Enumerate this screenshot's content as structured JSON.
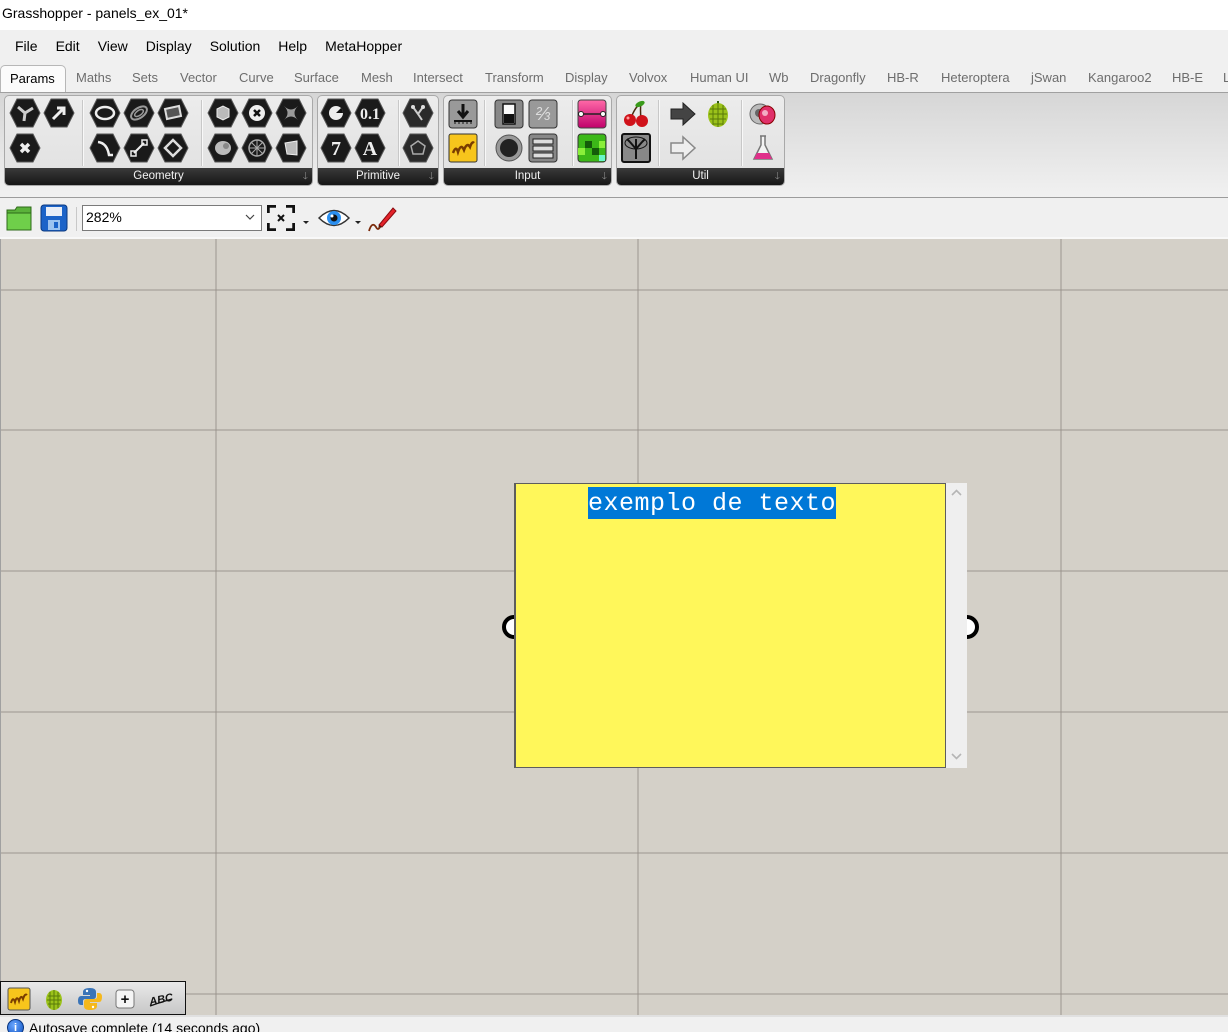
{
  "window": {
    "title": "Grasshopper - panels_ex_01*"
  },
  "menubar": {
    "items": [
      "File",
      "Edit",
      "View",
      "Display",
      "Solution",
      "Help",
      "MetaHopper"
    ]
  },
  "tabs": [
    {
      "label": "Params",
      "active": true
    },
    {
      "label": "Maths",
      "active": false
    },
    {
      "label": "Sets",
      "active": false
    },
    {
      "label": "Vector",
      "active": false
    },
    {
      "label": "Curve",
      "active": false
    },
    {
      "label": "Surface",
      "active": false
    },
    {
      "label": "Mesh",
      "active": false
    },
    {
      "label": "Intersect",
      "active": false
    },
    {
      "label": "Transform",
      "active": false
    },
    {
      "label": "Display",
      "active": false
    },
    {
      "label": "Volvox",
      "active": false
    },
    {
      "label": "Human UI",
      "active": false
    },
    {
      "label": "Wb",
      "active": false
    },
    {
      "label": "Dragonfly",
      "active": false
    },
    {
      "label": "HB-R",
      "active": false
    },
    {
      "label": "Heteroptera",
      "active": false
    },
    {
      "label": "jSwan",
      "active": false
    },
    {
      "label": "Kangaroo2",
      "active": false
    },
    {
      "label": "HB-E",
      "active": false
    },
    {
      "label": "L",
      "active": false
    }
  ],
  "ribbon": {
    "panels": [
      {
        "label": "Geometry",
        "expand_icon": "arrow-down-icon"
      },
      {
        "label": "Primitive",
        "expand_icon": "arrow-down-icon"
      },
      {
        "label": "Input",
        "expand_icon": "arrow-down-icon"
      },
      {
        "label": "Util",
        "expand_icon": "arrow-down-icon"
      }
    ],
    "expand_glyph": "🡓",
    "primitive_labels": {
      "number": "0.1",
      "integer": "7",
      "text": "A"
    }
  },
  "toolbar": {
    "zoom_value": "282%",
    "icons": [
      "open-file-icon",
      "save-file-icon",
      "zoom-extents-icon",
      "preview-eye-icon",
      "sketch-pen-icon"
    ]
  },
  "canvas": {
    "background": "#d4d0c8",
    "panel_component": {
      "text": "exemplo de texto",
      "fill_color": "#fff75a",
      "selection_color": "#0078d7"
    }
  },
  "widget_bar": {
    "icons": [
      "slider-widget-icon",
      "hops-icon",
      "python-icon",
      "add-panel-icon",
      "abc-text-icon"
    ],
    "add_glyph": "+",
    "abc_label": "ABC"
  },
  "statusbar": {
    "icon": "info-icon",
    "icon_glyph": "i",
    "text": "Autosave complete (14 seconds ago)"
  }
}
